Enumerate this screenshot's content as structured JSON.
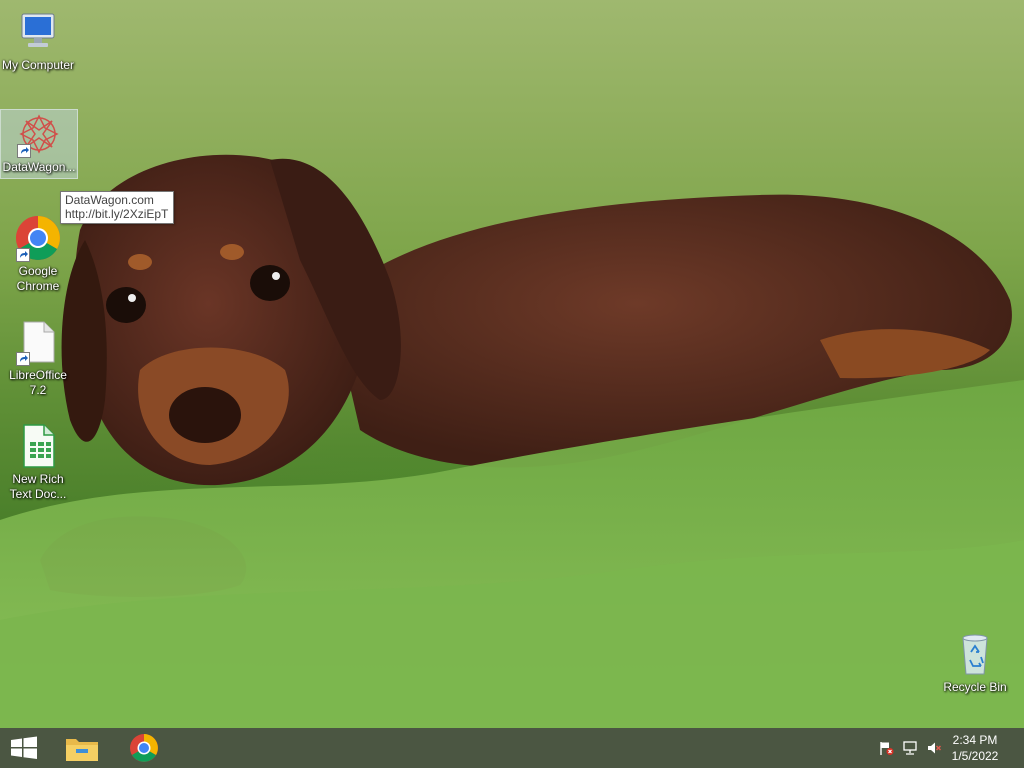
{
  "desktop": {
    "icons": [
      {
        "label": "My Computer",
        "icon": "computer-icon"
      },
      {
        "label": "DataWagon...",
        "icon": "datawagon-icon",
        "selected": true
      },
      {
        "label": "Google Chrome",
        "icon": "chrome-icon"
      },
      {
        "label": "LibreOffice 7.2",
        "icon": "libreoffice-icon"
      },
      {
        "label": "New Rich Text Doc...",
        "icon": "spreadsheet-document-icon"
      },
      {
        "label": "Recycle Bin",
        "icon": "recycle-bin-icon"
      }
    ],
    "tooltip": {
      "line1": "DataWagon.com",
      "line2": "http://bit.ly/2XziEpT"
    }
  },
  "taskbar": {
    "start_icon": "windows-start-icon",
    "apps": [
      {
        "name": "File Explorer",
        "icon": "file-explorer-icon"
      },
      {
        "name": "Google Chrome",
        "icon": "chrome-icon"
      }
    ],
    "tray": {
      "icons": [
        "action-center-flag-icon",
        "network-icon",
        "volume-muted-icon"
      ],
      "time": "2:34 PM",
      "date": "1/5/2022"
    }
  },
  "colors": {
    "taskbar": "#3c4832",
    "tooltip_border": "#767676",
    "selection": "#c8dcf0"
  }
}
